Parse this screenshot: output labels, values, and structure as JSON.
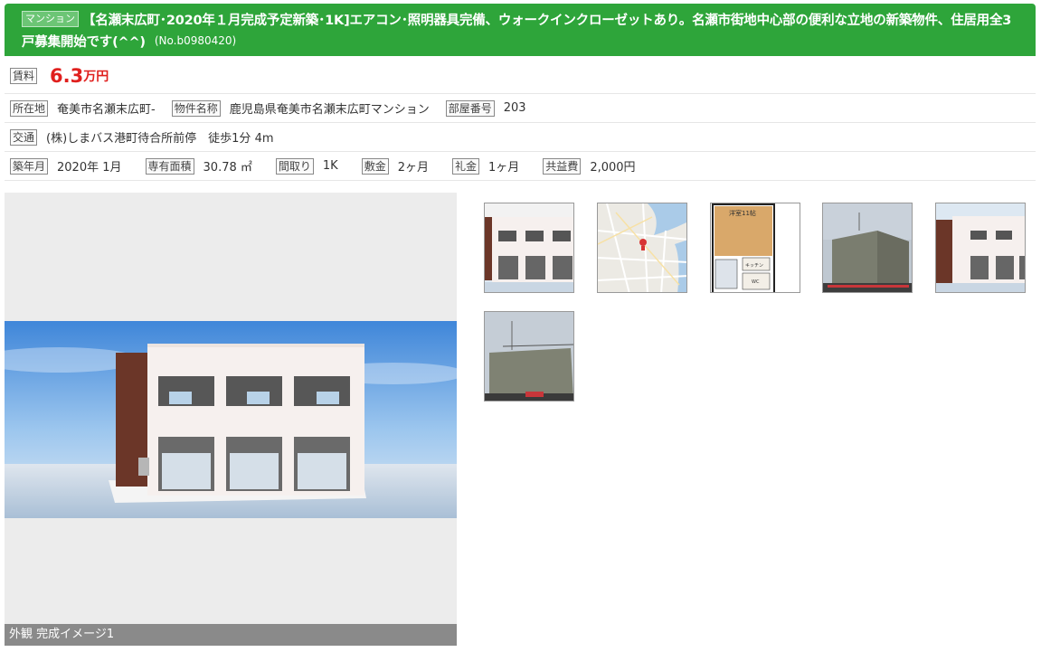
{
  "header": {
    "type_badge": "マンション",
    "title_line1": "【名瀬末広町･2020年１月完成予定新築･1K]エアコン･照明器具完備、ウォークインクローゼットあり。名瀬市街地中心部の便利な立地の新築物件、住居用全3",
    "title_line2": "戸募集開始です(^^)",
    "property_no": "(No.b0980420)",
    "background_color": "#2ea53a"
  },
  "rent": {
    "label": "賃料",
    "amount": "6.3",
    "unit": "万円",
    "color": "#e0201e"
  },
  "location_row": {
    "address_label": "所在地",
    "address": "奄美市名瀬末広町-",
    "name_label": "物件名称",
    "name": "鹿児島県奄美市名瀬末広町マンション",
    "room_label": "部屋番号",
    "room": "203"
  },
  "access_row": {
    "label": "交通",
    "value": "(株)しまバス港町待合所前停　徒歩1分 4m"
  },
  "spec_row": {
    "built_label": "築年月",
    "built": "2020年 1月",
    "area_label": "専有面積",
    "area": "30.78 ㎡",
    "layout_label": "間取り",
    "layout": "1K",
    "deposit_label": "敷金",
    "deposit": "2ヶ月",
    "key_money_label": "礼金",
    "key_money": "1ヶ月",
    "common_fee_label": "共益費",
    "common_fee": "2,000円"
  },
  "main_photo": {
    "caption": "外観 完成イメージ1"
  },
  "thumbnails": [
    {
      "icon": "building-render-thumb"
    },
    {
      "icon": "map-thumb"
    },
    {
      "icon": "floorplan-thumb",
      "room_text": "洋室11帖",
      "kitchen_text": "キッチン",
      "wc_text": "WC"
    },
    {
      "icon": "construction-photo-thumb"
    },
    {
      "icon": "building-render-thumb"
    },
    {
      "icon": "construction-photo-thumb"
    }
  ]
}
